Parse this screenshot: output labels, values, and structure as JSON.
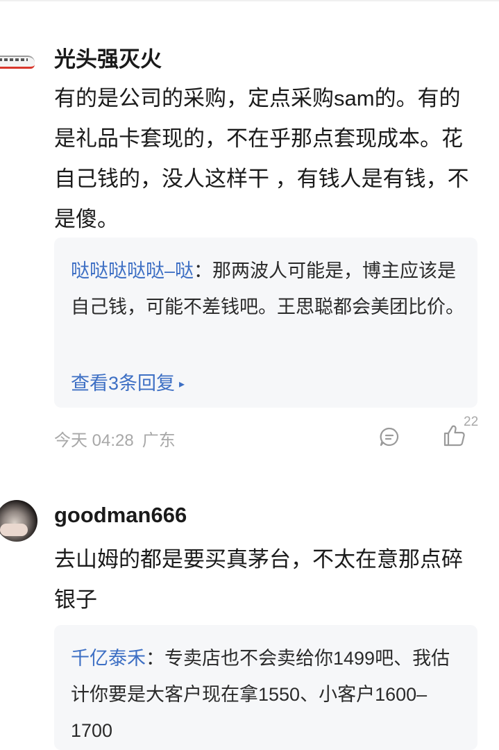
{
  "comments": [
    {
      "username": "光头强灭火",
      "content": "有的是公司的采购，定点采购sam的。有的是礼品卡套现的，不在乎那点套现成本。花自己钱的，没人这样干 ，有钱人是有钱，不是傻。",
      "reply_preview": {
        "author": "哒哒哒哒哒–哒",
        "separator": "：",
        "text": "那两波人可能是，博主应该是自己钱，可能不差钱吧。王思聪都会美团比价。",
        "view_replies_label": "查看3条回复",
        "arrow_icon": "▸"
      },
      "time": "今天 04:28",
      "location": "广东",
      "icons": [
        "comment-icon",
        "thumbs-up-icon"
      ],
      "likes": "22"
    },
    {
      "username": "goodman666",
      "content": "去山姆的都是要买真茅台，不太在意那点碎银子",
      "reply_preview": {
        "author": "千亿泰禾",
        "separator": "：",
        "text": "专卖店也不会卖给你1499吧、我估计你要是大客户现在拿1550、小客户1600–1700"
      }
    }
  ],
  "colors": {
    "link": "#3d6fc4",
    "meta": "#a8a8a8",
    "reply_bg": "#f6f7f9"
  }
}
